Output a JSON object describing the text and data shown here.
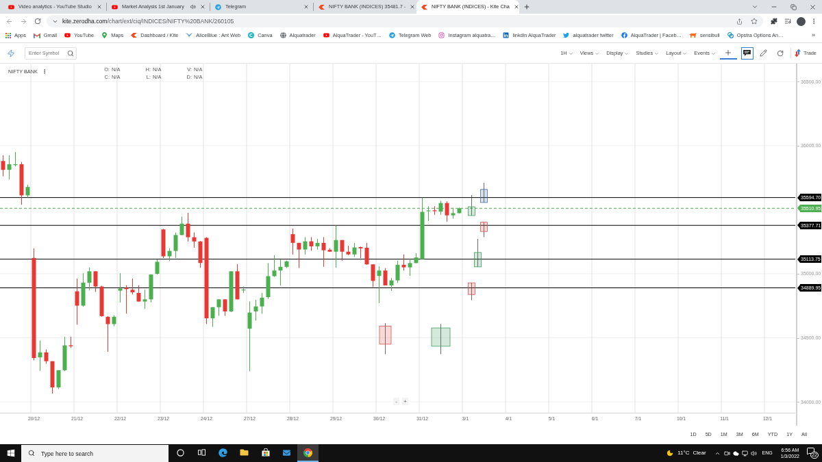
{
  "browser": {
    "tabs": [
      {
        "kind": "youtube",
        "title": "Video analytics - YouTube Studio",
        "audio": false,
        "selected": false
      },
      {
        "kind": "youtube",
        "title": "Market Analysis 1st January",
        "audio": true,
        "selected": false
      },
      {
        "kind": "telegram",
        "title": "Telegram",
        "audio": false,
        "selected": false
      },
      {
        "kind": "kite",
        "title": "NIFTY BANK (INDICES) 35481.7 -",
        "audio": false,
        "selected": false
      },
      {
        "kind": "kite",
        "title": "NIFTY BANK (INDICES) - Kite Cha",
        "audio": false,
        "selected": true
      }
    ],
    "address": {
      "host": "kite.zerodha.com",
      "path": "/chart/ext/ciq/INDICES/NIFTY%20BANK/260105"
    },
    "bookmarks": [
      {
        "kind": "apps",
        "label": "Apps"
      },
      {
        "kind": "gmail",
        "label": "Gmail"
      },
      {
        "kind": "youtube",
        "label": "YouTube"
      },
      {
        "kind": "maps",
        "label": "Maps"
      },
      {
        "kind": "kite",
        "label": "Dashboard / Kite"
      },
      {
        "kind": "aliceblue",
        "label": "AliceBlue : Ant Web"
      },
      {
        "kind": "canva",
        "label": "Canva"
      },
      {
        "kind": "globe",
        "label": "Alquatrader"
      },
      {
        "kind": "youtube",
        "label": "AlquaTrader - YouT…"
      },
      {
        "kind": "telegram",
        "label": "Telegram Web"
      },
      {
        "kind": "instagram",
        "label": "Instagram alquatra…"
      },
      {
        "kind": "linkedin",
        "label": "linkdin AlquaTrader"
      },
      {
        "kind": "twitter",
        "label": "alquatrader twitter"
      },
      {
        "kind": "facebook",
        "label": "AlquaTrader | Faceb…"
      },
      {
        "kind": "sensibull",
        "label": "sensibull"
      },
      {
        "kind": "opstra",
        "label": "Opstra Options An…"
      }
    ],
    "bookmarks_overflow": "»"
  },
  "chart_toolbar": {
    "search": {
      "placeholder": "Enter Symbol"
    },
    "menus": [
      "1H",
      "Views",
      "Display",
      "Studies",
      "Layout",
      "Events"
    ],
    "tools": [
      {
        "kind": "crosshair",
        "selected": true
      },
      {
        "kind": "comment",
        "selected": true
      },
      {
        "kind": "draw",
        "selected": false
      },
      {
        "kind": "reset",
        "selected": false
      }
    ],
    "trade": "Trade"
  },
  "chart": {
    "symbol": "NIFTY BANK",
    "quote_fields": [
      {
        "label": "O:",
        "value": "N/A"
      },
      {
        "label": "H:",
        "value": "N/A"
      },
      {
        "label": "V:",
        "value": "N/A"
      },
      {
        "label": "C:",
        "value": "N/A"
      },
      {
        "label": "L:",
        "value": "N/A"
      },
      {
        "label": "D:",
        "value": "N/A"
      }
    ],
    "zoom_controls": [
      "-",
      "+"
    ],
    "chart_data": [
      {
        "type": "candlestick",
        "categories": [
          null,
          null,
          null,
          null,
          null,
          "20/12",
          null,
          null,
          null,
          null,
          null,
          null,
          "21/12",
          null,
          null,
          null,
          null,
          null,
          null,
          "22/12",
          null,
          null,
          null,
          null,
          null,
          null,
          "23/12",
          null,
          null,
          null,
          null,
          null,
          null,
          "24/12",
          null,
          null,
          null,
          null,
          null,
          null,
          "27/12",
          null,
          null,
          null,
          null,
          null,
          null,
          "28/12",
          null,
          null,
          null,
          null,
          null,
          null,
          "29/12",
          null,
          null,
          null,
          null,
          null,
          null,
          "30/12",
          null,
          null,
          null,
          null,
          null,
          null,
          "31/12",
          null,
          null,
          null,
          null,
          null,
          null,
          "3/1",
          null,
          null,
          null,
          null,
          null,
          null,
          "4/1",
          null,
          null,
          null,
          null,
          null,
          null,
          "5/1",
          null,
          null,
          null,
          null,
          null,
          null,
          "6/1",
          null,
          null,
          null,
          null,
          null,
          null,
          "7/1",
          null,
          null,
          null,
          null,
          null,
          null,
          "10/1",
          null,
          null,
          null,
          null,
          null,
          null,
          "11/1",
          null,
          null,
          null,
          null,
          null,
          null,
          "12/1",
          null,
          null,
          null,
          null
        ],
        "ohlc": [
          [
            35880,
            35925,
            35761,
            35811
          ],
          [
            35811,
            35925,
            35736,
            35855
          ],
          [
            35848,
            35950,
            35838,
            35855
          ],
          [
            35855,
            35873,
            35538,
            35612
          ],
          [
            35612,
            35695,
            35595,
            35677
          ],
          [
            35123,
            35198,
            34324,
            34342
          ],
          [
            34347,
            34478,
            34242,
            34386
          ],
          [
            34386,
            34409,
            34297,
            34317
          ],
          [
            34317,
            34317,
            34064,
            34113
          ],
          [
            34113,
            34247,
            34100,
            34247
          ],
          [
            34247,
            34508,
            34240,
            34441
          ],
          [
            34441,
            34508,
            34421,
            34434
          ],
          [
            34863,
            34962,
            34602,
            34751
          ],
          [
            34751,
            35004,
            34743,
            34930
          ],
          [
            34930,
            35049,
            34870,
            35019
          ],
          [
            35019,
            35019,
            34858,
            34900
          ],
          [
            34900,
            34905,
            34665,
            34669
          ],
          [
            34664,
            34669,
            34391,
            34607
          ],
          [
            34607,
            34676,
            34590,
            34664
          ],
          [
            34868,
            35004,
            34776,
            34885
          ],
          [
            34890,
            34910,
            34689,
            34880
          ],
          [
            34875,
            34962,
            34838,
            34855
          ],
          [
            34850,
            34910,
            34783,
            34783
          ],
          [
            34783,
            34875,
            34726,
            34800
          ],
          [
            34800,
            34994,
            34776,
            34994
          ],
          [
            34999,
            35111,
            34994,
            35093
          ],
          [
            35346,
            35350,
            35123,
            35136
          ],
          [
            35136,
            35198,
            35098,
            35178
          ],
          [
            35178,
            35322,
            35123,
            35302
          ],
          [
            35302,
            35446,
            35302,
            35391
          ],
          [
            35391,
            35476,
            35252,
            35285
          ],
          [
            35285,
            35322,
            35203,
            35252
          ],
          [
            35252,
            35255,
            35046,
            35084
          ],
          [
            35280,
            35285,
            34607,
            34652
          ],
          [
            34652,
            34739,
            34585,
            34739
          ],
          [
            34739,
            34800,
            34671,
            34800
          ],
          [
            34800,
            34800,
            34671,
            34706
          ],
          [
            34706,
            35019,
            34700,
            35019
          ],
          [
            35019,
            35074,
            34800,
            34800
          ],
          [
            34870,
            34900,
            34850,
            34876
          ],
          [
            34571,
            34784,
            34239,
            34697
          ],
          [
            34706,
            34797,
            34633,
            34745
          ],
          [
            34745,
            34851,
            34687,
            34813
          ],
          [
            34818,
            35083,
            34803,
            34981
          ],
          [
            34981,
            35145,
            34975,
            35025
          ],
          [
            35025,
            35112,
            34909,
            35054
          ],
          [
            35054,
            35102,
            35044,
            35097
          ],
          [
            35309,
            35353,
            35150,
            35241
          ],
          [
            35241,
            35241,
            35044,
            35189
          ],
          [
            35189,
            35286,
            35150,
            35253
          ],
          [
            35253,
            35286,
            35180,
            35214
          ],
          [
            35214,
            35272,
            35189,
            35241
          ],
          [
            35241,
            35286,
            35054,
            35183
          ],
          [
            35187,
            35199,
            35170,
            35172
          ],
          [
            35172,
            35377,
            35048,
            35263
          ],
          [
            35263,
            35263,
            35102,
            35172
          ],
          [
            35172,
            35218,
            35145,
            35151
          ],
          [
            35151,
            35241,
            35131,
            35205
          ],
          [
            35208,
            35212,
            35122,
            35198
          ],
          [
            35203,
            35241,
            35070,
            35073
          ],
          [
            35073,
            35073,
            34896,
            34944
          ],
          [
            34983,
            35058,
            34770,
            35025
          ],
          [
            35025,
            35044,
            34909,
            34909
          ],
          [
            34909,
            34967,
            34866,
            34948
          ],
          [
            34948,
            35102,
            34928,
            35070
          ],
          [
            35070,
            35151,
            35025,
            35050
          ],
          [
            35050,
            35118,
            34983,
            35083
          ],
          [
            35083,
            35160,
            35083,
            35127
          ],
          [
            35113,
            35595,
            35113,
            35483
          ],
          [
            35488,
            35527,
            35411,
            35494
          ],
          [
            35495,
            35527,
            35460,
            35488
          ],
          [
            35485,
            35570,
            35460,
            35552
          ],
          [
            35552,
            35566,
            35407,
            35456
          ],
          [
            35456,
            35514,
            35430,
            35473
          ],
          [
            35473,
            35516,
            35470,
            35511
          ],
          null,
          null,
          null,
          null,
          null,
          null,
          null,
          null,
          null,
          null,
          null,
          null,
          null,
          null,
          null,
          null,
          null,
          null,
          null,
          null,
          null,
          null,
          null,
          null,
          null,
          null,
          null,
          null,
          null,
          null,
          null,
          null,
          null,
          null,
          null,
          null,
          null,
          null,
          null,
          null,
          null,
          null,
          null,
          null,
          null,
          null,
          null,
          null,
          null,
          null,
          null,
          null,
          null,
          null
        ],
        "series": [
          {
            "type": "candlestick",
            "color": "#d9534f",
            "ohlc": [
              null,
              null,
              null,
              null,
              null,
              null,
              null,
              null,
              null,
              null,
              null,
              null,
              null,
              null,
              null,
              null,
              null,
              null,
              null,
              null,
              null,
              null,
              null,
              null,
              null,
              null,
              null,
              null,
              null,
              null,
              null,
              null,
              null,
              null,
              null,
              null,
              null,
              null,
              null,
              null,
              null,
              null,
              null,
              null,
              null,
              null,
              null,
              null,
              null,
              null,
              null,
              null,
              null,
              null,
              null,
              null,
              null,
              null,
              null,
              null,
              null,
              null,
              [
                34591,
                34614,
                34372,
                34450
              ],
              null,
              null,
              null,
              null,
              null,
              null,
              null,
              null,
              null,
              null,
              null,
              null,
              null,
              null,
              null,
              null,
              null,
              null,
              null,
              null,
              null,
              null,
              null,
              null,
              null,
              null,
              null,
              null,
              null,
              null,
              null,
              null,
              null,
              null,
              null,
              null,
              null,
              null,
              null,
              null,
              null,
              null,
              null,
              null,
              null,
              null,
              null,
              null,
              null,
              null,
              null,
              null,
              null,
              null,
              null,
              null,
              null,
              null,
              null,
              null,
              null,
              null,
              null,
              null,
              null,
              null
            ]
          },
          {
            "type": "candlestick",
            "color": "#3c9d5d",
            "ohlc": [
              null,
              null,
              null,
              null,
              null,
              null,
              null,
              null,
              null,
              null,
              null,
              null,
              null,
              null,
              null,
              null,
              null,
              null,
              null,
              null,
              null,
              null,
              null,
              null,
              null,
              null,
              null,
              null,
              null,
              null,
              null,
              null,
              null,
              null,
              null,
              null,
              null,
              null,
              null,
              null,
              null,
              null,
              null,
              null,
              null,
              null,
              null,
              null,
              null,
              null,
              null,
              null,
              null,
              null,
              null,
              null,
              null,
              null,
              null,
              null,
              null,
              null,
              null,
              null,
              null,
              null,
              null,
              null,
              null,
              null,
              null,
              [
                34434,
                34608,
                34372,
                34577
              ],
              null,
              null,
              null,
              null,
              null,
              null,
              null,
              null,
              null,
              null,
              null,
              null,
              null,
              null,
              null,
              null,
              null,
              null,
              null,
              null,
              null,
              null,
              null,
              null,
              null,
              null,
              null,
              null,
              null,
              null,
              null,
              null,
              null,
              null,
              null,
              null,
              null,
              null,
              null,
              null,
              null,
              null,
              null,
              null,
              null,
              null,
              null,
              null,
              null,
              null,
              null,
              null,
              null,
              null,
              null,
              null,
              null
            ]
          },
          {
            "type": "candlestick",
            "color": "#3c9d5d",
            "ohlc": [
              null,
              null,
              null,
              null,
              null,
              null,
              null,
              null,
              null,
              null,
              null,
              null,
              null,
              null,
              null,
              null,
              null,
              null,
              null,
              null,
              null,
              null,
              null,
              null,
              null,
              null,
              null,
              null,
              null,
              null,
              null,
              null,
              null,
              null,
              null,
              null,
              null,
              null,
              null,
              null,
              null,
              null,
              null,
              null,
              null,
              null,
              null,
              null,
              null,
              null,
              null,
              null,
              null,
              null,
              null,
              null,
              null,
              null,
              null,
              null,
              null,
              null,
              null,
              null,
              null,
              null,
              null,
              null,
              null,
              null,
              null,
              null,
              null,
              null,
              null,
              null,
              [
                35454,
                35614,
                35454,
                35523
              ],
              [
                35054,
                35272,
                35054,
                35166
              ],
              null,
              null,
              null,
              null,
              null,
              null,
              null,
              null,
              null,
              null,
              null,
              null,
              null,
              null,
              null,
              null,
              null,
              null,
              null,
              null,
              null,
              null,
              null,
              null,
              null,
              null,
              null,
              null,
              null,
              null,
              null,
              null,
              null,
              null,
              null,
              null,
              null,
              null,
              null,
              null,
              null,
              null,
              null,
              null,
              null,
              null,
              null,
              null,
              null,
              null,
              null
            ]
          },
          {
            "type": "candlestick",
            "color": "#4a6fa5",
            "ohlc": [
              null,
              null,
              null,
              null,
              null,
              null,
              null,
              null,
              null,
              null,
              null,
              null,
              null,
              null,
              null,
              null,
              null,
              null,
              null,
              null,
              null,
              null,
              null,
              null,
              null,
              null,
              null,
              null,
              null,
              null,
              null,
              null,
              null,
              null,
              null,
              null,
              null,
              null,
              null,
              null,
              null,
              null,
              null,
              null,
              null,
              null,
              null,
              null,
              null,
              null,
              null,
              null,
              null,
              null,
              null,
              null,
              null,
              null,
              null,
              null,
              null,
              null,
              null,
              null,
              null,
              null,
              null,
              null,
              null,
              null,
              null,
              null,
              null,
              null,
              null,
              null,
              null,
              null,
              [
                35556,
                35710,
                35556,
                35658
              ],
              null,
              null,
              null,
              null,
              null,
              null,
              null,
              null,
              null,
              null,
              null,
              null,
              null,
              null,
              null,
              null,
              null,
              null,
              null,
              null,
              null,
              null,
              null,
              null,
              null,
              null,
              null,
              null,
              null,
              null,
              null,
              null,
              null,
              null,
              null,
              null,
              null,
              null,
              null,
              null,
              null,
              null,
              null,
              null,
              null,
              null,
              null,
              null,
              null,
              null
            ]
          },
          {
            "type": "candlestick",
            "color": "#d9534f",
            "ohlc": [
              null,
              null,
              null,
              null,
              null,
              null,
              null,
              null,
              null,
              null,
              null,
              null,
              null,
              null,
              null,
              null,
              null,
              null,
              null,
              null,
              null,
              null,
              null,
              null,
              null,
              null,
              null,
              null,
              null,
              null,
              null,
              null,
              null,
              null,
              null,
              null,
              null,
              null,
              null,
              null,
              null,
              null,
              null,
              null,
              null,
              null,
              null,
              null,
              null,
              null,
              null,
              null,
              null,
              null,
              null,
              null,
              null,
              null,
              null,
              null,
              null,
              null,
              null,
              null,
              null,
              null,
              null,
              null,
              null,
              null,
              null,
              null,
              null,
              null,
              null,
              null,
              [
                34929,
                34929,
                34793,
                34838
              ],
              null,
              [
                35402,
                35402,
                35286,
                35330
              ],
              null,
              null,
              null,
              null,
              null,
              null,
              null,
              null,
              null,
              null,
              null,
              null,
              null,
              null,
              null,
              null,
              null,
              null,
              null,
              null,
              null,
              null,
              null,
              null,
              null,
              null,
              null,
              null,
              null,
              null,
              null,
              null,
              null,
              null,
              null,
              null,
              null,
              null,
              null,
              null,
              null,
              null,
              null,
              null,
              null,
              null,
              null,
              null,
              null,
              null
            ]
          }
        ],
        "ylim": [
          33915,
          36640
        ],
        "yticks": [
          {
            "value": 34000,
            "label": "34000.00"
          },
          {
            "value": 34500,
            "label": "34500.00"
          },
          {
            "value": 35000,
            "label": "35000.00"
          },
          {
            "value": 36000,
            "label": "36000.00"
          },
          {
            "value": 36500,
            "label": "36500.00"
          }
        ],
        "ref_lines": [
          {
            "axis": "y",
            "value": 35594.7,
            "label": "35594.70",
            "color": "#000000",
            "line_style": "solid"
          },
          {
            "axis": "y",
            "value": 35510.95,
            "label": "35510.95",
            "color": "#4caf50",
            "line_style": "dashed"
          },
          {
            "axis": "y",
            "value": 35377.71,
            "label": "35377.71",
            "color": "#000000",
            "line_style": "solid"
          },
          {
            "axis": "y",
            "value": 35113.75,
            "label": "35113.75",
            "color": "#000000",
            "line_style": "solid"
          },
          {
            "axis": "y",
            "value": 34889.95,
            "label": "34889.95",
            "color": "#000000",
            "line_style": "solid"
          }
        ],
        "grid": true
      }
    ]
  },
  "range_buttons": [
    "1D",
    "5D",
    "1M",
    "3M",
    "6M",
    "YTD",
    "1Y",
    "All"
  ],
  "taskbar": {
    "search": {
      "placeholder": "Type here to search"
    },
    "apps": [
      {
        "kind": "cortana",
        "active": false
      },
      {
        "kind": "task_view",
        "active": false
      },
      {
        "kind": "edge",
        "active": false
      },
      {
        "kind": "explorer",
        "active": false
      },
      {
        "kind": "store",
        "active": false
      },
      {
        "kind": "mail",
        "active": false
      },
      {
        "kind": "chrome",
        "active": true
      }
    ],
    "weather": {
      "temperature": "11°C",
      "condition": "Clear"
    },
    "language": "ENG",
    "time": "6:56 AM",
    "date": "1/3/2022",
    "notifications": "22"
  }
}
